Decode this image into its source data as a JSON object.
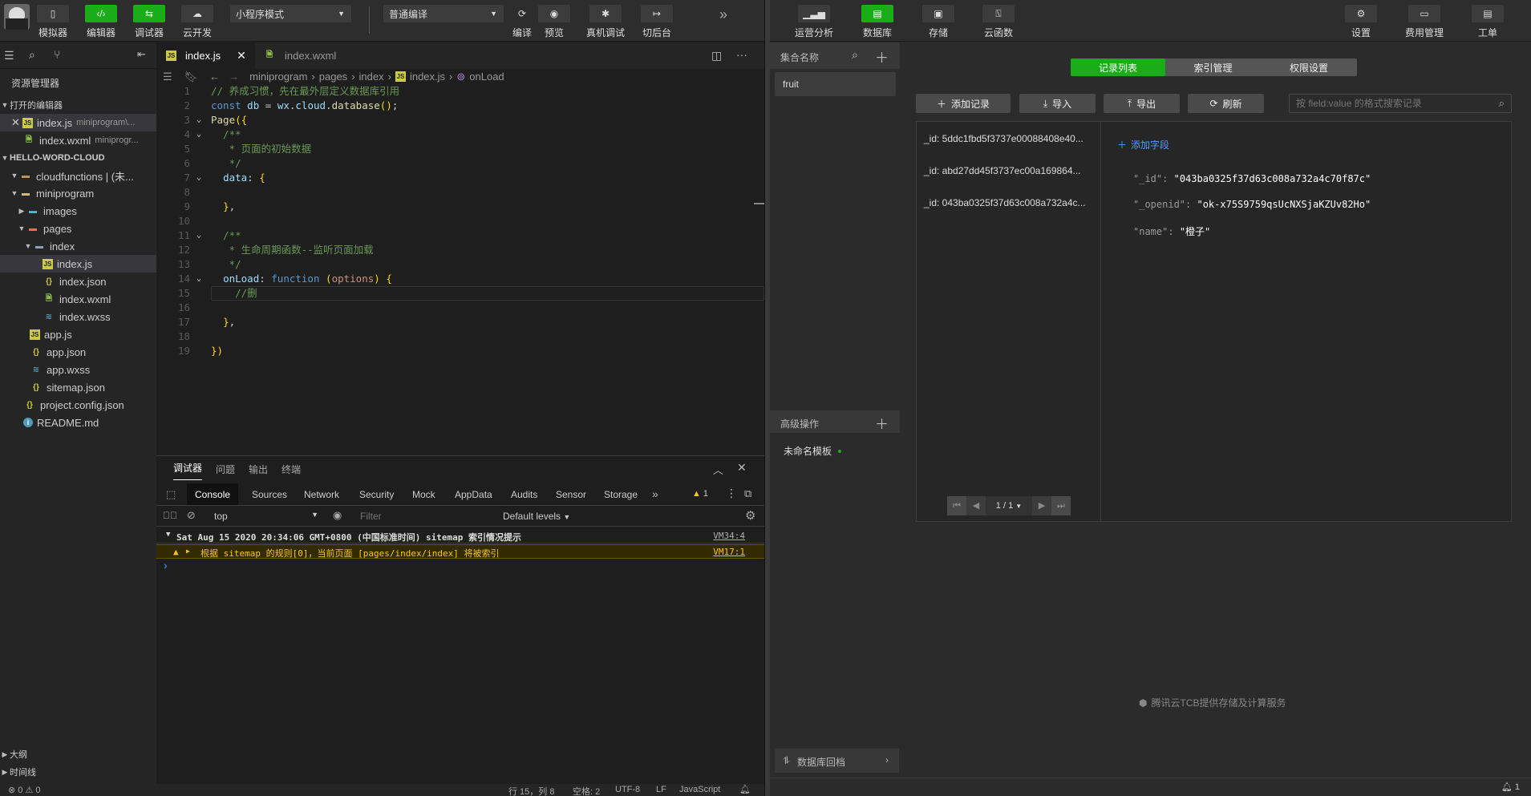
{
  "toolbar": {
    "buttons": [
      {
        "label": "模拟器",
        "icon": "phone-icon"
      },
      {
        "label": "编辑器",
        "icon": "code-icon"
      },
      {
        "label": "调试器",
        "icon": "debug-icon"
      },
      {
        "label": "云开发",
        "icon": "cloud-icon"
      }
    ],
    "mode_select": "小程序模式",
    "compile_select": "普通编译",
    "actions": [
      {
        "label": "编译",
        "icon": "refresh-icon"
      },
      {
        "label": "预览",
        "icon": "eye-icon"
      },
      {
        "label": "真机调试",
        "icon": "bug-icon"
      },
      {
        "label": "切后台",
        "icon": "switch-icon"
      }
    ],
    "more": "»"
  },
  "explorer": {
    "title": "资源管理器",
    "open_editors_label": "打开的编辑器",
    "open_editors": [
      {
        "name": "index.js",
        "path": "miniprogram\\..."
      },
      {
        "name": "index.wxml",
        "path": "miniprogr..."
      }
    ],
    "project_label": "HELLO-WORD-CLOUD",
    "tree": [
      {
        "name": "cloudfunctions | (未...",
        "type": "folder"
      },
      {
        "name": "miniprogram",
        "type": "folder"
      },
      {
        "name": "images",
        "type": "folder"
      },
      {
        "name": "pages",
        "type": "folder"
      },
      {
        "name": "index",
        "type": "folder"
      },
      {
        "name": "index.js",
        "type": "js"
      },
      {
        "name": "index.json",
        "type": "json"
      },
      {
        "name": "index.wxml",
        "type": "wxml"
      },
      {
        "name": "index.wxss",
        "type": "wxss"
      },
      {
        "name": "app.js",
        "type": "js"
      },
      {
        "name": "app.json",
        "type": "json"
      },
      {
        "name": "app.wxss",
        "type": "wxss"
      },
      {
        "name": "sitemap.json",
        "type": "json"
      },
      {
        "name": "project.config.json",
        "type": "json"
      },
      {
        "name": "README.md",
        "type": "info"
      }
    ],
    "outline_label": "大纲",
    "timeline_label": "时间线"
  },
  "editor": {
    "tabs": [
      {
        "name": "index.js"
      },
      {
        "name": "index.wxml"
      }
    ],
    "breadcrumb": [
      "miniprogram",
      "pages",
      "index",
      "index.js",
      "onLoad"
    ],
    "lines": [
      "// 养成习惯，先在最外层定义数据库引用",
      "const db = wx.cloud.database();",
      "Page({",
      "  /**",
      "   * 页面的初始数据",
      "   */",
      "  data: {",
      "",
      "  },",
      "",
      "  /**",
      "   * 生命周期函数--监听页面加载",
      "   */",
      "  onLoad: function (options) {",
      "    //删",
      "",
      "  },",
      "",
      "})"
    ]
  },
  "panel": {
    "tabs": [
      "调试器",
      "问题",
      "输出",
      "终端"
    ],
    "devtools_tabs": [
      "Console",
      "Sources",
      "Network",
      "Security",
      "Mock",
      "AppData",
      "Audits",
      "Sensor",
      "Storage"
    ],
    "warn_count": "1",
    "context": "top",
    "filter_placeholder": "Filter",
    "levels": "Default levels",
    "log_header": "Sat Aug 15 2020 20:34:06 GMT+0800 (中国标准时间) sitemap 索引情况提示",
    "log_header_src": "VM34:4",
    "log_warn": "根据 sitemap 的规则[0]，当前页面 [pages/index/index] 将被索引",
    "log_warn_src": "VM17:1",
    "prompt": "›"
  },
  "statusbar": {
    "errors": "⊗ 0 ⚠ 0",
    "position": "行 15，列 8",
    "spaces": "空格: 2",
    "encoding": "UTF-8",
    "eol": "LF",
    "language": "JavaScript"
  },
  "cloud": {
    "nav": [
      {
        "label": "运营分析",
        "icon": "chart-icon"
      },
      {
        "label": "数据库",
        "icon": "database-icon"
      },
      {
        "label": "存储",
        "icon": "storage-icon"
      },
      {
        "label": "云函数",
        "icon": "function-icon"
      }
    ],
    "nav_right": [
      {
        "label": "设置",
        "icon": "gear-icon"
      },
      {
        "label": "费用管理",
        "icon": "billing-icon"
      },
      {
        "label": "工单",
        "icon": "ticket-icon"
      }
    ],
    "collection_header": "集合名称",
    "collections": [
      "fruit"
    ],
    "advanced_label": "高级操作",
    "template": "未命名模板",
    "rollback": "数据库回档",
    "tabs": [
      "记录列表",
      "索引管理",
      "权限设置"
    ],
    "actions": [
      "添加记录",
      "导入",
      "导出",
      "刷新"
    ],
    "search_placeholder": "按 field:value 的格式搜索记录",
    "records": [
      "_id: 5ddc1fbd5f3737e00088408e40...",
      "_id: abd27dd45f3737ec00a169864...",
      "_id: 043ba0325f37d63c008a732a4c..."
    ],
    "add_field": "添加字段",
    "fields": [
      {
        "key": "\"_id\":",
        "value": "\"043ba0325f37d63c008a732a4c70f87c\""
      },
      {
        "key": "\"_openid\":",
        "value": "\"ok-x75S9759qsUcNXSjaKZUv82Ho\""
      },
      {
        "key": "\"name\":",
        "value": "\"橙子\""
      }
    ],
    "pagination": "1 / 1",
    "footer": "腾讯云TCB提供存储及计算服务",
    "bell_count": "1"
  }
}
